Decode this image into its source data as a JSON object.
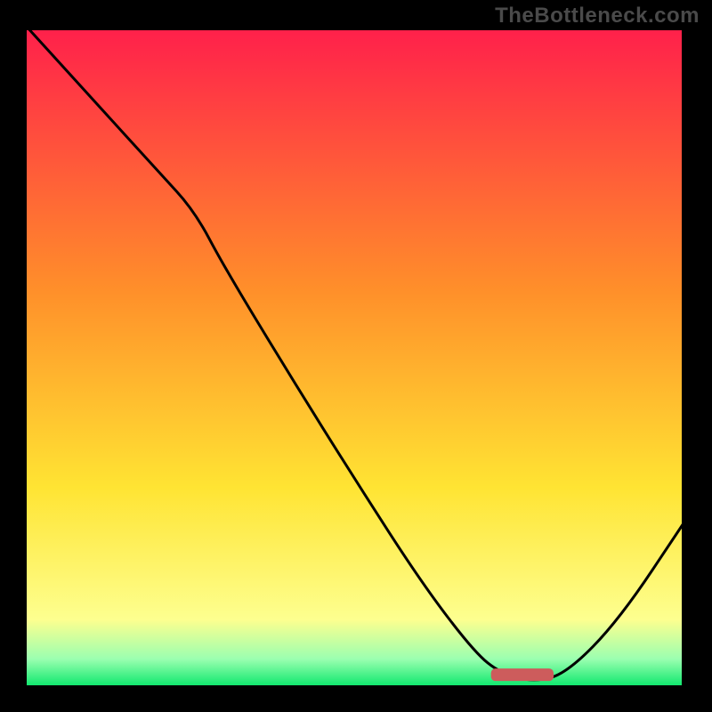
{
  "watermark": "TheBottleneck.com",
  "colors": {
    "gradient_top": "#ff1f4b",
    "gradient_mid_warm": "#ff8f2a",
    "gradient_mid_yellow": "#ffe433",
    "gradient_low_yellow": "#fdff8f",
    "gradient_band": "#9bffb0",
    "gradient_bottom": "#12e86f",
    "curve": "#000000",
    "marker": "#cd5c5c",
    "frame": "#000000"
  },
  "chart_data": {
    "type": "line",
    "title": "",
    "xlabel": "",
    "ylabel": "",
    "xlim": [
      0,
      100
    ],
    "ylim": [
      0,
      100
    ],
    "notes": "Axes are unlabeled; values are relative positions estimated from pixels (0–100 each axis). Curve shows a steep descent from top-left to a minimum near x≈77, then rises to the right edge. A short horizontal marker segment sits at the valley floor.",
    "series": [
      {
        "name": "curve",
        "x": [
          0,
          10,
          20,
          25.5,
          30,
          40,
          50,
          60,
          68,
          72,
          77,
          82,
          90,
          100
        ],
        "y": [
          100,
          89,
          78,
          72,
          63.5,
          47,
          31,
          15.5,
          5,
          1.8,
          0.5,
          1.8,
          10,
          25
        ]
      }
    ],
    "marker": {
      "name": "valley-marker",
      "x_start": 70.5,
      "x_end": 80,
      "y": 1.6
    },
    "gradient_stops_y_to_color": [
      {
        "y": 100,
        "color": "#ff1f4b"
      },
      {
        "y": 60,
        "color": "#ff8f2a"
      },
      {
        "y": 30,
        "color": "#ffe433"
      },
      {
        "y": 10,
        "color": "#fdff8f"
      },
      {
        "y": 4,
        "color": "#9bffb0"
      },
      {
        "y": 0,
        "color": "#12e86f"
      }
    ]
  }
}
